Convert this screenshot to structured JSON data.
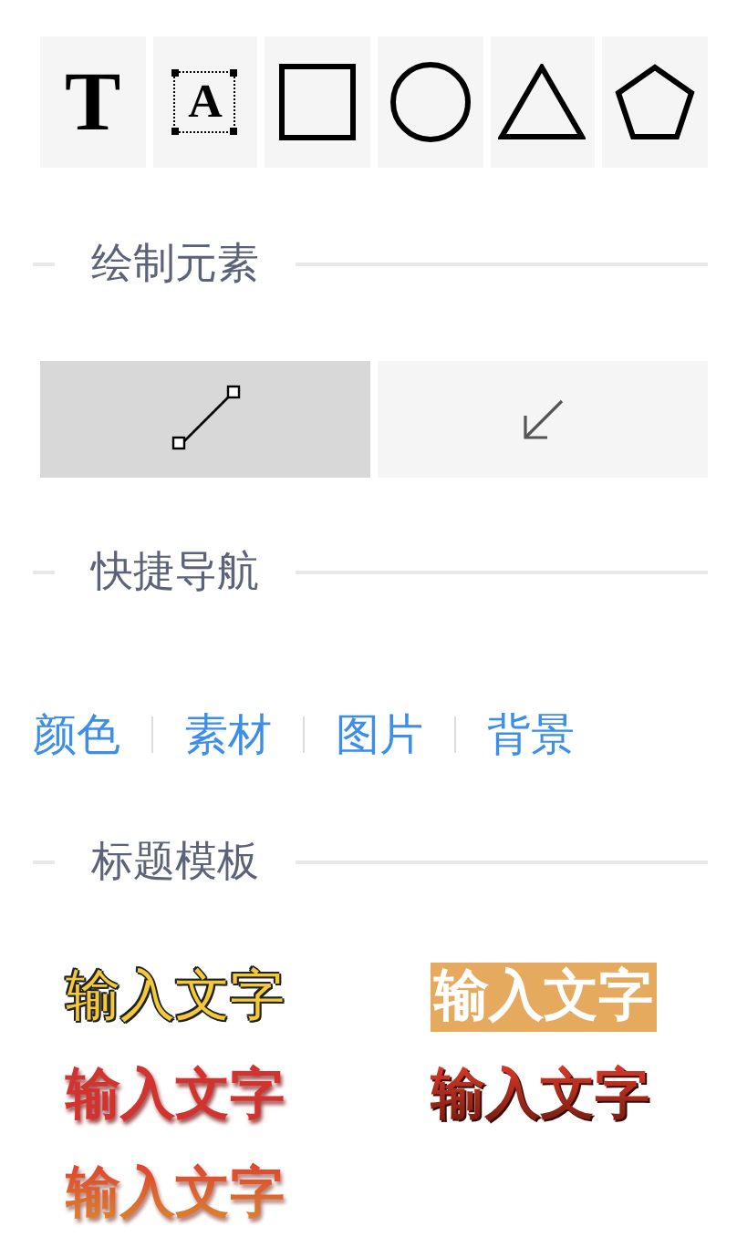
{
  "tools": [
    {
      "kind": "text",
      "glyph": "T"
    },
    {
      "kind": "textbox",
      "glyph": "A"
    },
    {
      "kind": "rect"
    },
    {
      "kind": "circle"
    },
    {
      "kind": "triangle"
    },
    {
      "kind": "pentagon"
    }
  ],
  "sections": [
    {
      "title": "绘制元素"
    },
    {
      "title": "快捷导航"
    },
    {
      "title": "标题模板"
    }
  ],
  "draw_modes": [
    {
      "kind": "line",
      "selected": true
    },
    {
      "kind": "arrow",
      "selected": false
    }
  ],
  "nav_links": [
    "颜色",
    "素材",
    "图片",
    "背景"
  ],
  "templates": [
    {
      "kind": "outline",
      "text": "输入文字"
    },
    {
      "kind": "badge",
      "text": "输入文字"
    },
    {
      "kind": "shadow",
      "text": "输入文字"
    },
    {
      "kind": "dark-gradient",
      "text": "输入文字"
    },
    {
      "kind": "orange-gradient",
      "text": "输入文字"
    }
  ]
}
